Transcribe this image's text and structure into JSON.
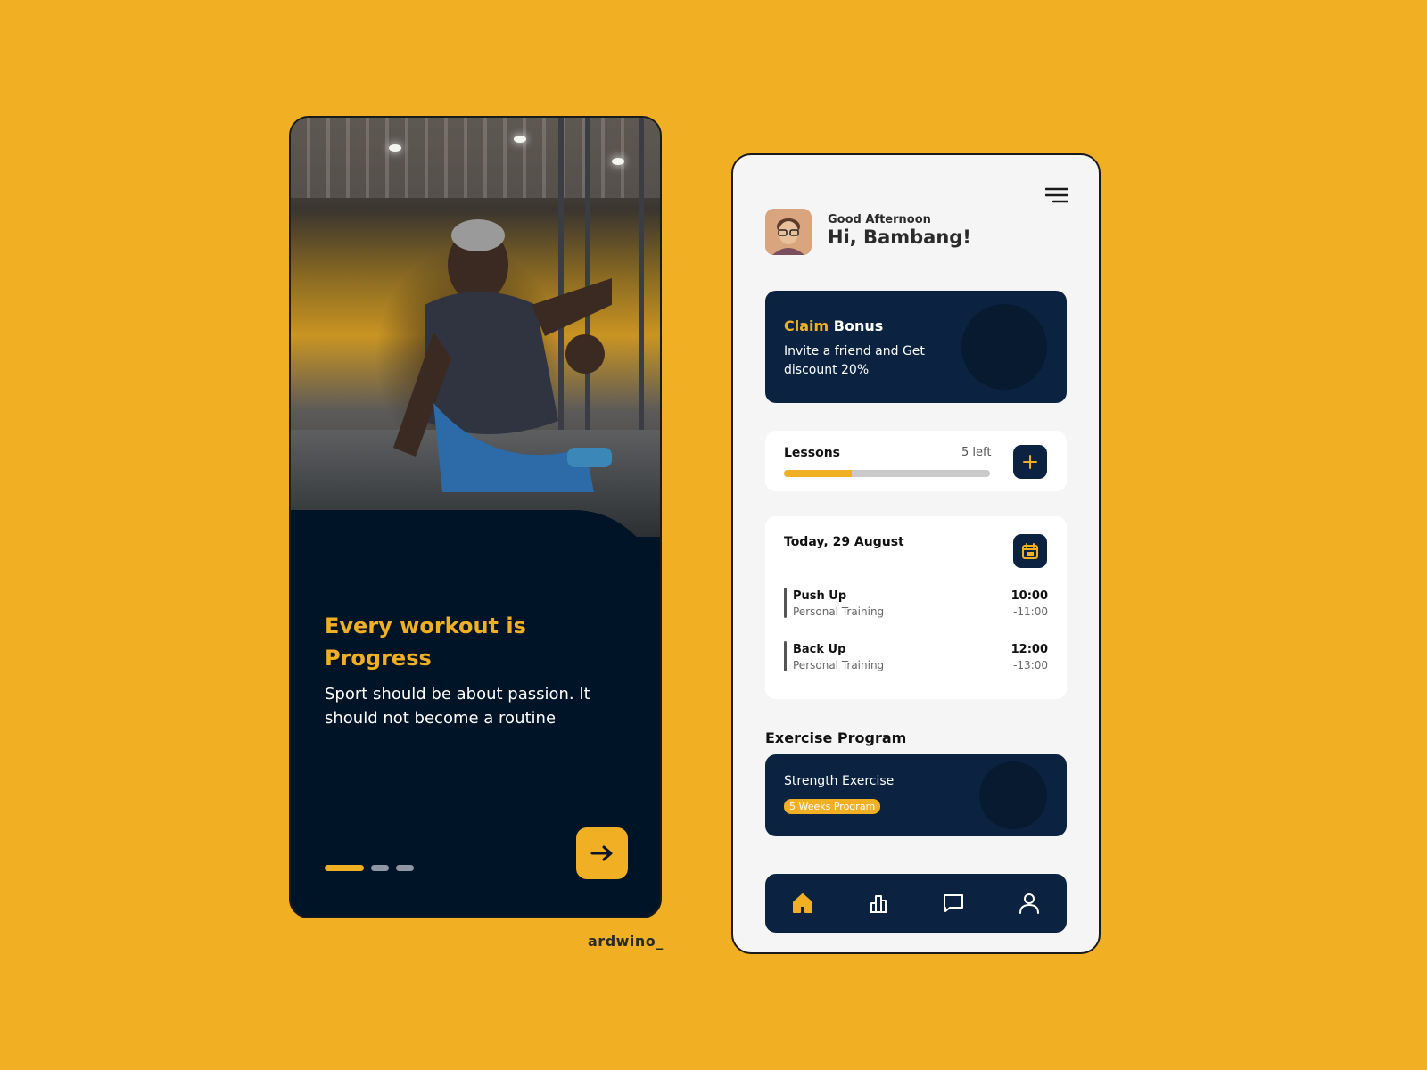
{
  "colors": {
    "background": "#F1B023",
    "accent": "#F1B023",
    "navy": "#0B2340",
    "dark": "#001427",
    "card": "#FFFFFF"
  },
  "onboarding": {
    "title": "Every workout is Progress",
    "subtitle": "Sport should be about passion. It should not become a routine",
    "pagination": {
      "total": 3,
      "active": 1
    },
    "next_icon": "arrow-right-icon"
  },
  "signature": "ardwino_",
  "dashboard": {
    "menu_icon": "hamburger-menu-icon",
    "greeting": "Good Afternoon",
    "user_greeting": "Hi, Bambang!",
    "bonus": {
      "title_accent": "Claim",
      "title_rest": "Bonus",
      "text": "Invite a friend and Get discount 20%"
    },
    "lessons": {
      "label": "Lessons",
      "remaining": "5 left",
      "progress_fraction": 0.33,
      "add_icon": "plus-icon"
    },
    "schedule": {
      "date": "Today, 29 August",
      "calendar_icon": "calendar-icon",
      "items": [
        {
          "name": "Push Up",
          "type": "Personal Training",
          "start": "10:00",
          "end": "-11:00"
        },
        {
          "name": "Back Up",
          "type": "Personal Training",
          "start": "12:00",
          "end": "-13:00"
        }
      ]
    },
    "exercise": {
      "heading": "Exercise Program",
      "title": "Strength Exercise",
      "badge": "5 Weeks Program"
    },
    "nav": [
      "home-icon",
      "stats-icon",
      "chat-icon",
      "profile-icon"
    ]
  }
}
